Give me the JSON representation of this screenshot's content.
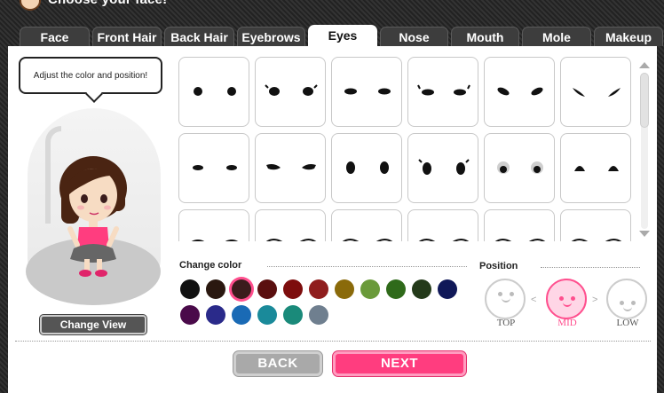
{
  "header": {
    "title": "Choose your face!"
  },
  "tabs": [
    {
      "label": "Face"
    },
    {
      "label": "Front Hair"
    },
    {
      "label": "Back Hair"
    },
    {
      "label": "Eyebrows"
    },
    {
      "label": "Eyes",
      "active": true
    },
    {
      "label": "Nose"
    },
    {
      "label": "Mouth"
    },
    {
      "label": "Mole"
    },
    {
      "label": "Makeup"
    }
  ],
  "bubble": {
    "text": "Adjust the color and position!"
  },
  "preview": {
    "change_view_label": "Change View"
  },
  "eye_options": [
    {
      "style": "round-dots"
    },
    {
      "style": "round-lashes"
    },
    {
      "style": "flat-ovals"
    },
    {
      "style": "lashed-flat"
    },
    {
      "style": "slanted-ovals"
    },
    {
      "style": "sharp-slant"
    },
    {
      "style": "narrow-ovals"
    },
    {
      "style": "thick-lashes"
    },
    {
      "style": "tall-ovals"
    },
    {
      "style": "tall-lashed"
    },
    {
      "style": "grey-shadow"
    },
    {
      "style": "half-moon"
    },
    {
      "style": "row3-a"
    },
    {
      "style": "row3-b"
    },
    {
      "style": "row3-c"
    },
    {
      "style": "row3-d"
    },
    {
      "style": "row3-e"
    },
    {
      "style": "row3-f"
    }
  ],
  "color_section": {
    "title": "Change color",
    "selected_index": 2,
    "colors": [
      "#111111",
      "#2a1810",
      "#3b1c1c",
      "#5a0f0f",
      "#7d0d0d",
      "#8f1d1d",
      "#8a6a0a",
      "#6a9a3a",
      "#2f6a1a",
      "#243a1a",
      "#101858",
      "#4a0a4a",
      "#2a2a8a",
      "#1a6ab5",
      "#1a8a9a",
      "#1a8a7a",
      "#6f7f8f"
    ]
  },
  "position_section": {
    "title": "Position",
    "options": [
      {
        "label": "TOP"
      },
      {
        "label": "MID",
        "selected": true
      },
      {
        "label": "LOW"
      }
    ]
  },
  "buttons": {
    "back_label": "BACK",
    "next_label": "NEXT"
  }
}
